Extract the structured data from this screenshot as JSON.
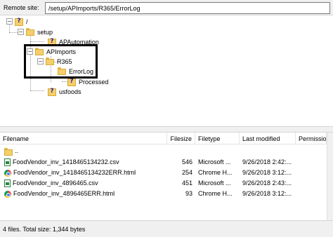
{
  "site_bar": {
    "label": "Remote site:",
    "path": "/setup/APImports/R365/ErrorLog"
  },
  "tree": {
    "root": {
      "label": "/",
      "toggle": "−"
    },
    "setup": {
      "label": "setup",
      "toggle": "−"
    },
    "apautomation": {
      "label": "APAutomation"
    },
    "apimports": {
      "label": "APImports",
      "toggle": "−"
    },
    "r365": {
      "label": "R365",
      "toggle": "−"
    },
    "errorlog": {
      "label": "ErrorLog"
    },
    "processed": {
      "label": "Processed"
    },
    "usfoods": {
      "label": "usfoods"
    }
  },
  "list": {
    "columns": [
      "Filename",
      "Filesize",
      "Filetype",
      "Last modified",
      "Permission"
    ],
    "rows": [
      {
        "name": "..",
        "size": "",
        "type": "",
        "modified": ""
      },
      {
        "name": "FoodVendor_inv_1418465134232.csv",
        "size": "546",
        "type": "Microsoft ...",
        "modified": "9/26/2018 2:42:..."
      },
      {
        "name": "FoodVendor_inv_1418465134232ERR.html",
        "size": "254",
        "type": "Chrome H...",
        "modified": "9/26/2018 3:12:..."
      },
      {
        "name": "FoodVendor_inv_4896465.csv",
        "size": "451",
        "type": "Microsoft ...",
        "modified": "9/26/2018 2:43:..."
      },
      {
        "name": "FoodVendor_inv_4896465ERR.html",
        "size": "93",
        "type": "Chrome H...",
        "modified": "9/26/2018 3:12:..."
      }
    ]
  },
  "status": {
    "text": "4 files. Total size: 1,344 bytes"
  }
}
